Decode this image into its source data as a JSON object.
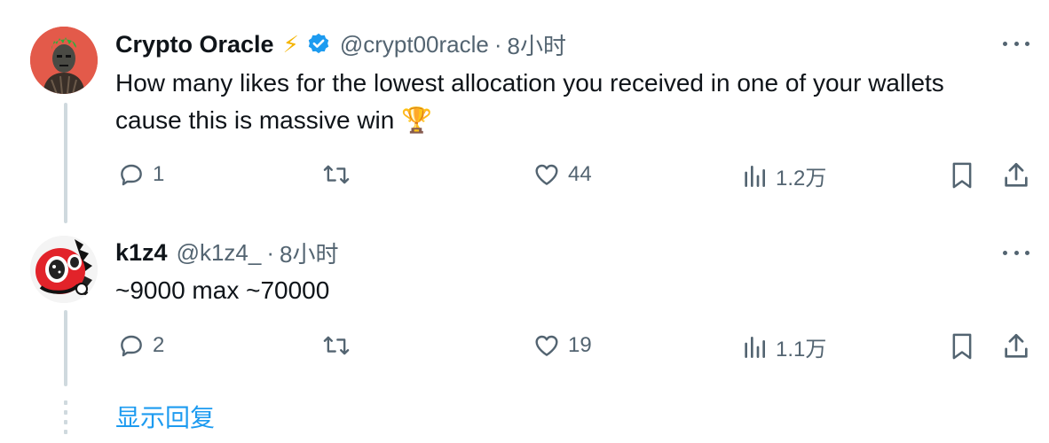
{
  "tweet": {
    "author_name": "Crypto Oracle",
    "emoji_after_name": "⚡",
    "handle": "@crypt00racle",
    "separator": "·",
    "time": "8小时",
    "text_line1": "How many likes for the lowest allocation you received in one of your wallets",
    "text_line2": "cause this is massive win",
    "text_emoji": "🏆",
    "actions": {
      "reply_count": "1",
      "repost_count": "",
      "like_count": "44",
      "views_count": "1.2万"
    }
  },
  "reply": {
    "author_name": "k1z4",
    "handle": "@k1z4_",
    "separator": "·",
    "time": "8小时",
    "text": "~9000 max ~70000",
    "actions": {
      "reply_count": "2",
      "repost_count": "",
      "like_count": "19",
      "views_count": "1.1万"
    }
  },
  "show_replies_label": "显示回复",
  "colors": {
    "accent": "#1d9bf0",
    "secondary_text": "#536471",
    "primary_text": "#0f1419",
    "thread_line": "#cfd9de",
    "avatar1_bg": "#e35a4a",
    "lightning": "#f5b400"
  }
}
